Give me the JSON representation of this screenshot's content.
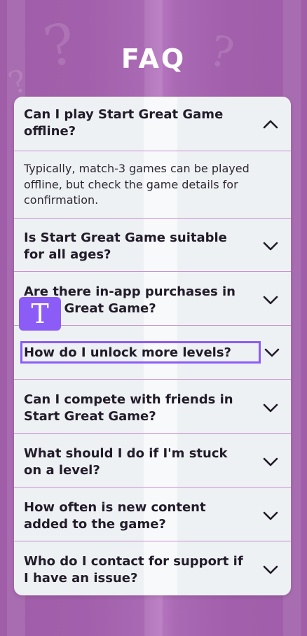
{
  "header": {
    "title": "FAQ"
  },
  "faq": {
    "items": [
      {
        "question": "Can I play Start Great Game offline?",
        "expanded": true,
        "answer": "Typically, match-3 games can be played offline, but check the game details for confirmation."
      },
      {
        "question": "Is Start Great Game suitable for all ages?",
        "expanded": false
      },
      {
        "question": "Are there in-app purchases in Start Great Game?",
        "expanded": false
      },
      {
        "question": "How do I unlock more levels?",
        "expanded": false,
        "focused": true
      },
      {
        "question": "Can I compete with friends in Start Great Game?",
        "expanded": false
      },
      {
        "question": "What should I do if I'm stuck on a level?",
        "expanded": false
      },
      {
        "question": "How often is new content added to the game?",
        "expanded": false
      },
      {
        "question": "Who do I contact for support if I have an issue?",
        "expanded": false
      }
    ]
  },
  "overlay": {
    "ime_label": "T",
    "icon": "text-input-icon"
  },
  "colors": {
    "background": "#a05ea9",
    "card": "#eef1f4",
    "divider": "#c98fcf",
    "focus": "#8b5cf6",
    "text": "#221b2a"
  }
}
